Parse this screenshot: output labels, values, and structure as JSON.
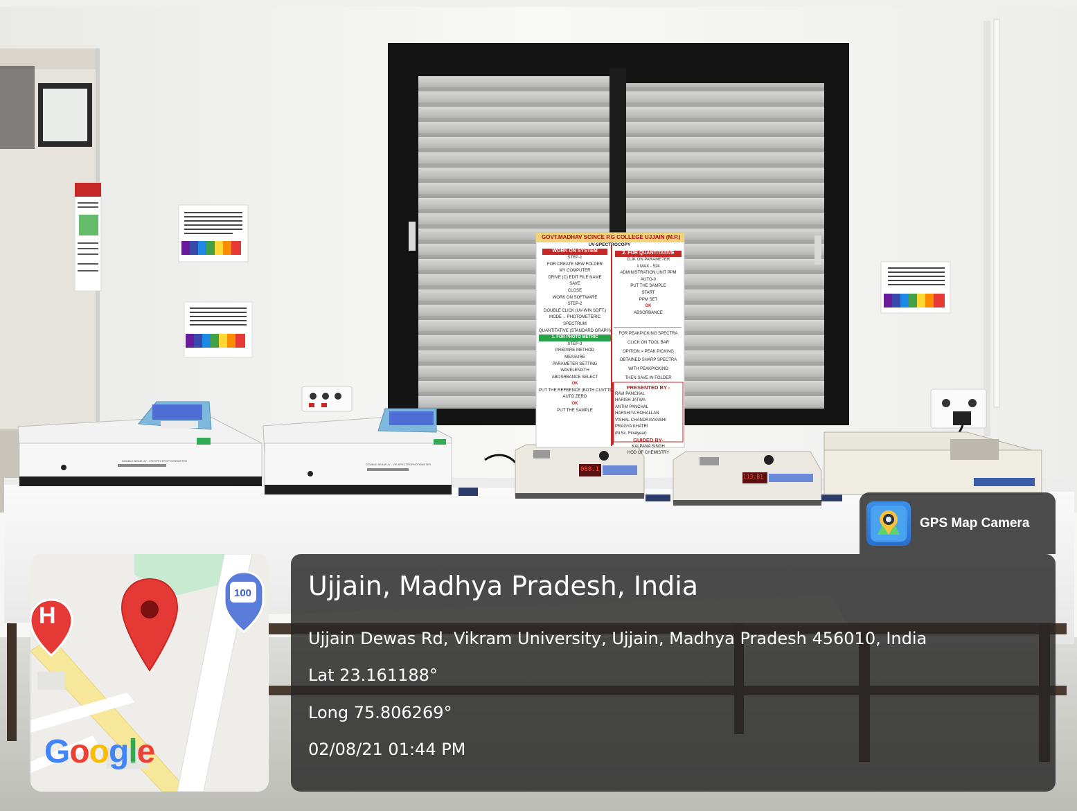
{
  "poster": {
    "title": "GOVT.MADHAV SCINCE P.G COLLEGE UJJAIN (M.P.)",
    "subtitle": "UV-SPECTROCOPY",
    "left_header": "WORK ON SYSTEM",
    "right_header": "2. FOR QUANTITATIVE",
    "left_lines": [
      "STEP-1",
      "FOR CREATE NEW FOLDER",
      "MY COMPUTER",
      "DRIVE (C) EDIT FILE NAME",
      "SAVE",
      "CLOSE",
      "WORK ON SOFTWARE",
      "STEP-2",
      "DOUBLE CLICK (UV-WIN SOFT.)",
      "MODE→ PHOTOMETERIC",
      "SPECTRUM",
      "QUANTITATIVE (STANDARD GRAPH)"
    ],
    "left_mid_header": "1. FOR PHOTO METRIC",
    "left_lines2": [
      "STEP-3",
      "PREPARE METHOD",
      "MEASURE",
      "PARAMETER SETTING",
      "WAVELENGTH",
      "ABOSRBANCE SELECT",
      "OK",
      "PUT THE REFRENCE (BOTH CUVTTE)",
      "AUTO ZERO",
      "OK",
      "PUT THE SAMPLE"
    ],
    "right_lines": [
      "CLIK ON PARAMETER",
      "λ MAX - 524",
      "ADMINISTRATION UNIT PPM",
      "AUTO-0",
      "PUT THE SAMPLE",
      "START",
      "PPM SET",
      "OK",
      "ABSORBANCE"
    ],
    "right_lines2": [
      "FOR PEAKPICKING SPECTRA",
      "CLICK ON TOOL BAR",
      "OPITION > PEAK PICKING",
      "OBTAINED SHARP SPECTRA",
      "WITH PEAKPICKING",
      "THEN SAVE IN FOLDER"
    ],
    "presented_header": "PRESENTED BY -",
    "presenters": [
      "RAVI PANCHAL",
      "HARISH JATWA",
      "ANTIM PANCHAL",
      "HARSHITA ROHALLAN",
      "VISHAL CHANDRAVANSHI",
      "PRAGYA KHATRI",
      "(M.Sc. Finalyear)"
    ],
    "guided_header": "GUIDED BY-",
    "guides": [
      "KALPANA SINGH",
      "HOD OF CHEMISTRY"
    ]
  },
  "instrument_labels": {
    "uv1": "DOUBLE BEAM UV - VIS SPECTROPHOTOMETER",
    "uv2": "DOUBLE BEAM UV - VIS SPECTROPHOTOMETER",
    "display1": "088.1",
    "display2": "113.81"
  },
  "overlay": {
    "app_name": "GPS Map Camera",
    "place": "Ujjain, Madhya Pradesh, India",
    "address": "Ujjain Dewas Rd, Vikram University, Ujjain, Madhya Pradesh 456010, India",
    "lat": "Lat 23.161188°",
    "long": "Long 75.806269°",
    "datetime": "02/08/21 01:44 PM",
    "map_logo": [
      "G",
      "o",
      "o",
      "g",
      "l",
      "e"
    ],
    "map_marker_letter": "H",
    "map_sign_number": "100"
  },
  "colors": {
    "wall": "#f4f4f2",
    "window_frame": "#141414",
    "tablecloth": "#f7f7f7",
    "overlay_bg": "#262626",
    "map_pin": "#e53935"
  }
}
